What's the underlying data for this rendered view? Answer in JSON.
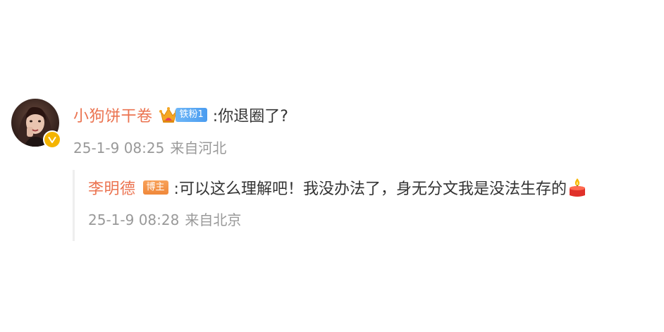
{
  "comment": {
    "username": "小狗饼干卷",
    "fan_badge": "铁粉1",
    "text": ":你退圈了?",
    "timestamp": "25-1-9 08:25",
    "location": "来自河北",
    "avatar_icon": "avatar-photo",
    "verified_icon": "verified-badge-icon",
    "crown_icon": "crown-icon"
  },
  "reply": {
    "username": "李明德",
    "role_badge": "博主",
    "text": ":可以这么理解吧！我没办法了，身无分文我是没法生存的",
    "emoji_icon": "candle-icon",
    "timestamp": "25-1-9 08:28",
    "location": "来自北京"
  },
  "colors": {
    "username": "#eb7350",
    "meta": "#999999",
    "text": "#333333",
    "fan_badge": "#5aa8f4",
    "blogger_badge": "#f0883a",
    "verified": "#f4b400"
  }
}
